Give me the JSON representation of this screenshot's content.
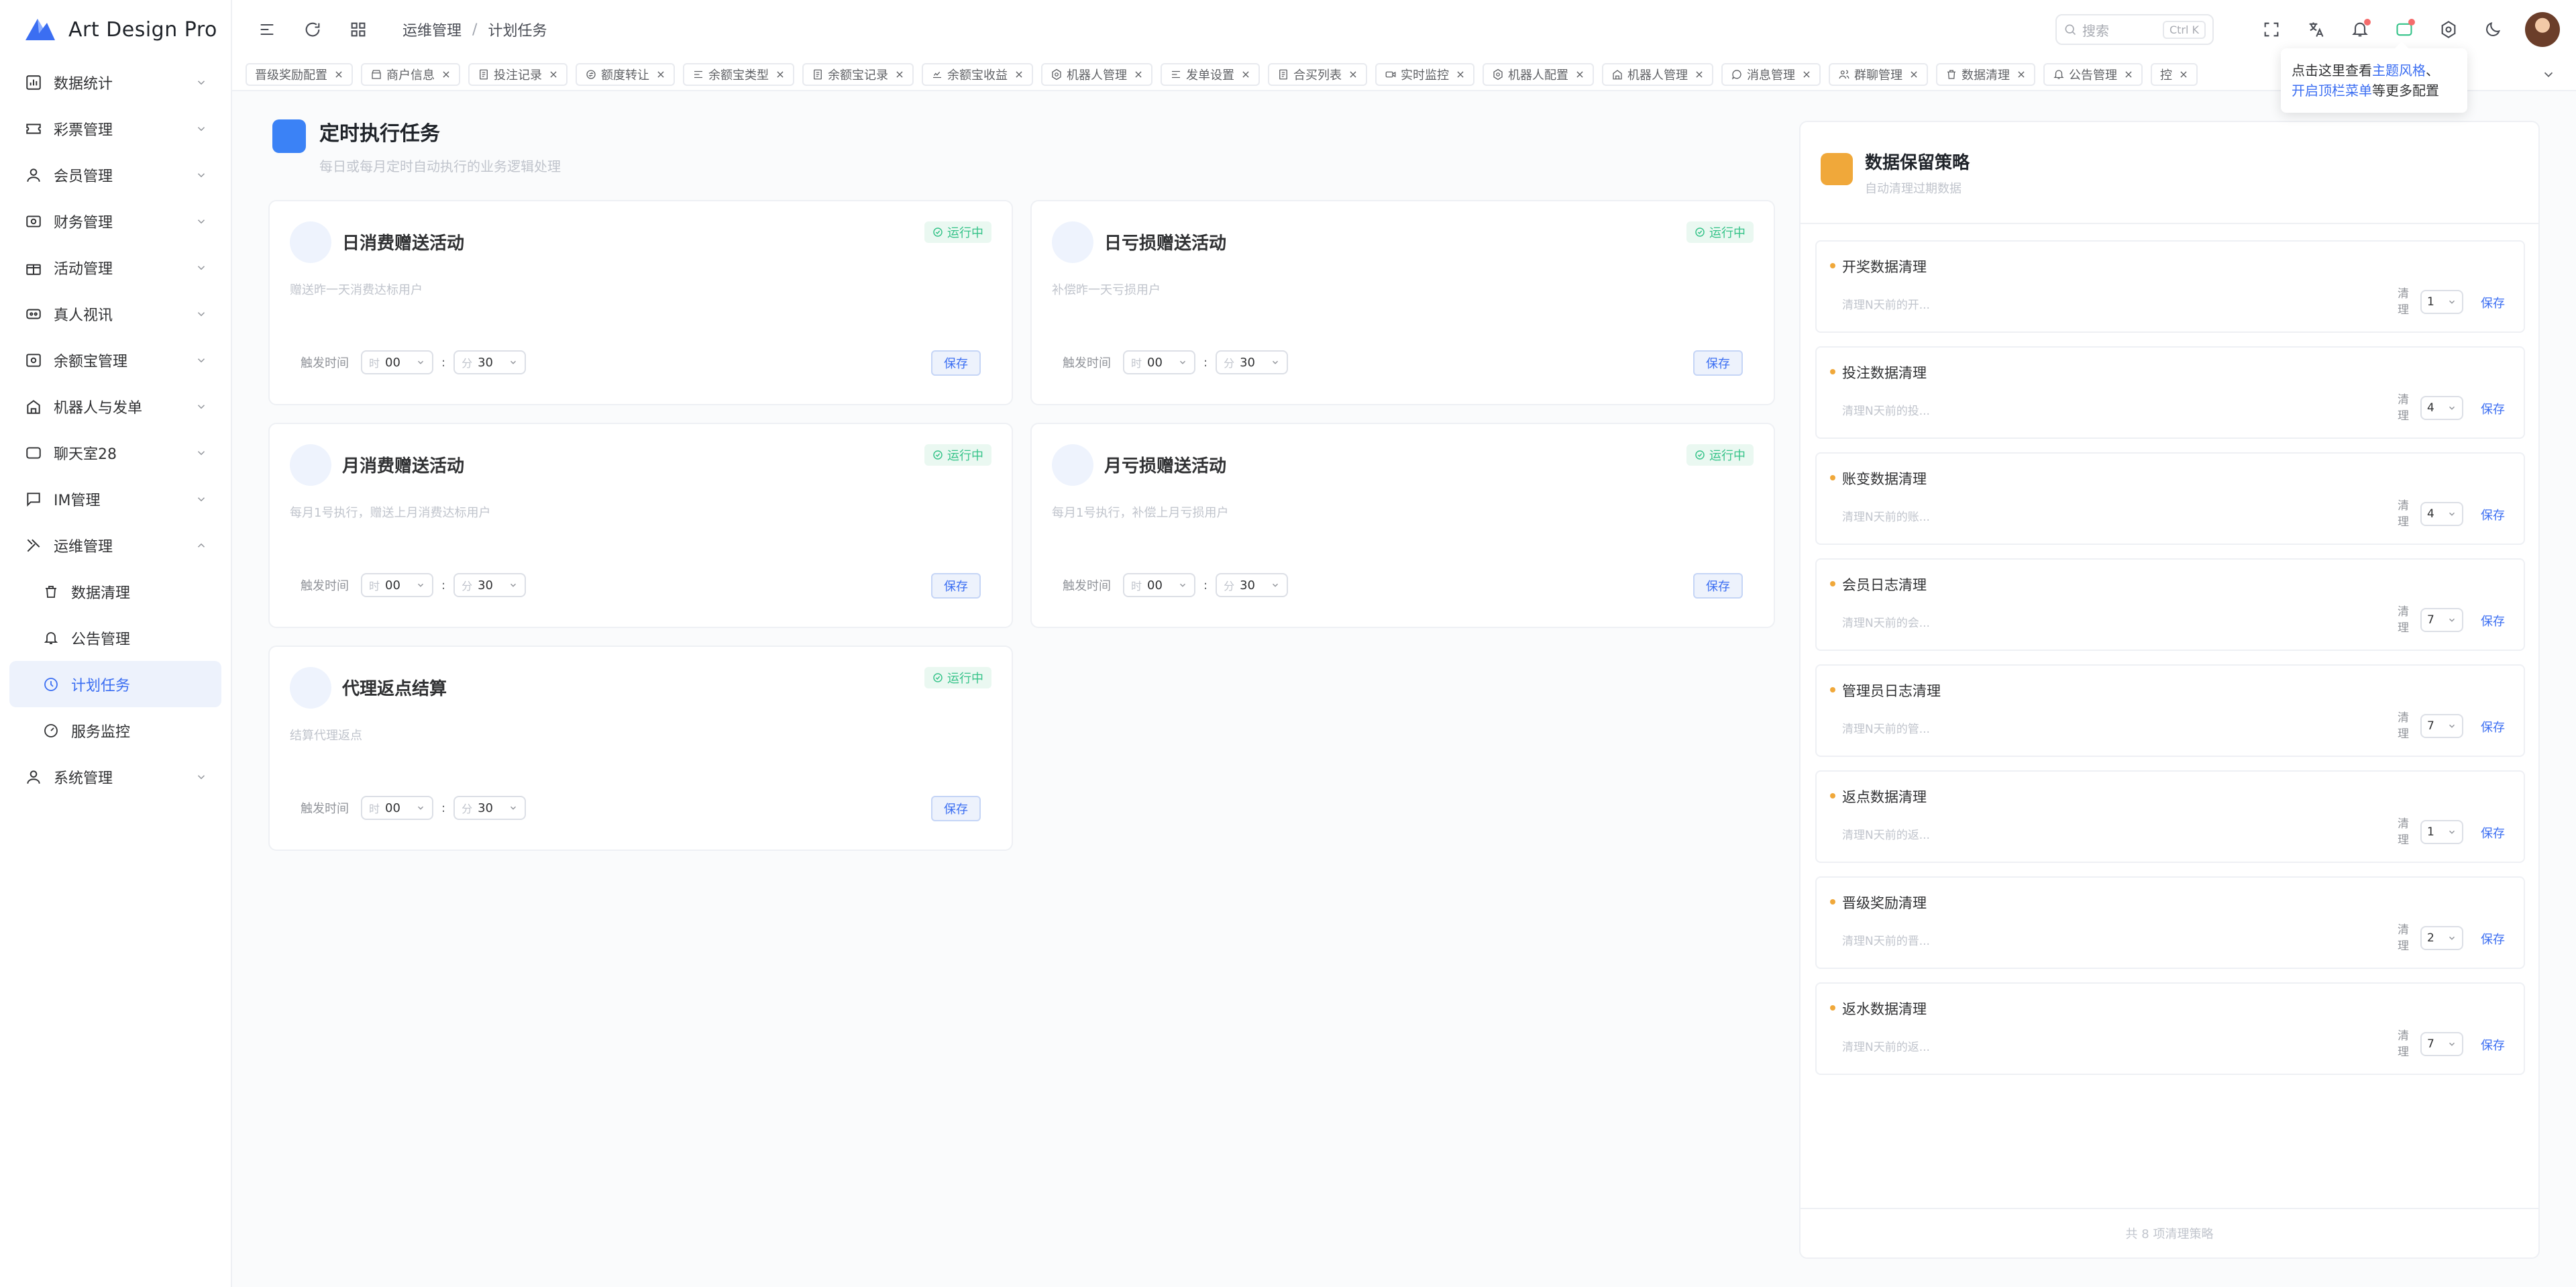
{
  "app": {
    "title": "Art Design Pro"
  },
  "sidebar": {
    "items": [
      {
        "label": "数据统计",
        "icon": "chart-icon"
      },
      {
        "label": "彩票管理",
        "icon": "ticket-icon"
      },
      {
        "label": "会员管理",
        "icon": "user-icon"
      },
      {
        "label": "财务管理",
        "icon": "finance-icon"
      },
      {
        "label": "活动管理",
        "icon": "gift-icon"
      },
      {
        "label": "真人视讯",
        "icon": "video-icon"
      },
      {
        "label": "余额宝管理",
        "icon": "wallet-icon"
      },
      {
        "label": "机器人与发单",
        "icon": "robot-icon"
      },
      {
        "label": "聊天室28",
        "icon": "chat-icon"
      },
      {
        "label": "IM管理",
        "icon": "message-icon"
      },
      {
        "label": "运维管理",
        "icon": "tools-icon"
      }
    ],
    "subitems": [
      {
        "label": "数据清理",
        "icon": "trash-icon"
      },
      {
        "label": "公告管理",
        "icon": "bell-icon"
      },
      {
        "label": "计划任务",
        "icon": "clock-icon"
      },
      {
        "label": "服务监控",
        "icon": "gauge-icon"
      }
    ],
    "last": {
      "label": "系统管理",
      "icon": "user-icon"
    }
  },
  "header": {
    "breadcrumb": [
      "运维管理",
      "计划任务"
    ],
    "search_placeholder": "搜索",
    "search_kbd": "Ctrl K"
  },
  "tabs": [
    {
      "label": "晋级奖励配置",
      "icon": ""
    },
    {
      "label": "商户信息",
      "icon": "store-icon"
    },
    {
      "label": "投注记录",
      "icon": "doc-icon"
    },
    {
      "label": "额度转让",
      "icon": "transfer-icon"
    },
    {
      "label": "余额宝类型",
      "icon": "list-icon"
    },
    {
      "label": "余额宝记录",
      "icon": "doc-icon"
    },
    {
      "label": "余额宝收益",
      "icon": "wallet-icon"
    },
    {
      "label": "机器人管理",
      "icon": "gear-icon"
    },
    {
      "label": "发单设置",
      "icon": "list-icon"
    },
    {
      "label": "合买列表",
      "icon": "doc-icon"
    },
    {
      "label": "实时监控",
      "icon": "video-icon"
    },
    {
      "label": "机器人配置",
      "icon": "gear-icon"
    },
    {
      "label": "机器人管理",
      "icon": "robot-icon"
    },
    {
      "label": "消息管理",
      "icon": "chat-icon"
    },
    {
      "label": "群聊管理",
      "icon": "users-icon"
    },
    {
      "label": "数据清理",
      "icon": "trash-icon"
    },
    {
      "label": "公告管理",
      "icon": "bell-icon"
    }
  ],
  "tab_partial": "控",
  "tooltip": {
    "prefix": "点击这里查看",
    "link1": "主题风格",
    "mid": "、",
    "link2": "开启顶栏菜单",
    "suffix": "等更多配置"
  },
  "section": {
    "title": "定时执行任务",
    "subtitle": "每日或每月定时自动执行的业务逻辑处理"
  },
  "common": {
    "trigger_label": "触发时间",
    "hour_prefix": "时",
    "minute_prefix": "分",
    "save": "保存",
    "status": "运行中"
  },
  "tasks": [
    {
      "title": "日消费赠送活动",
      "desc": "赠送昨一天消费达标用户",
      "hour": "00",
      "minute": "30"
    },
    {
      "title": "日亏损赠送活动",
      "desc": "补偿昨一天亏损用户",
      "hour": "00",
      "minute": "30"
    },
    {
      "title": "月消费赠送活动",
      "desc": "每月1号执行，赠送上月消费达标用户",
      "hour": "00",
      "minute": "30"
    },
    {
      "title": "月亏损赠送活动",
      "desc": "每月1号执行，补偿上月亏损用户",
      "hour": "00",
      "minute": "30"
    },
    {
      "title": "代理返点结算",
      "desc": "结算代理返点",
      "hour": "00",
      "minute": "30"
    }
  ],
  "retention": {
    "title": "数据保留策略",
    "subtitle": "自动清理过期数据",
    "clean_label": "清理",
    "save": "保存",
    "footer": "共 8 项清理策略",
    "policies": [
      {
        "title": "开奖数据清理",
        "placeholder": "清理N天前的开...",
        "value": "1"
      },
      {
        "title": "投注数据清理",
        "placeholder": "清理N天前的投...",
        "value": "4"
      },
      {
        "title": "账变数据清理",
        "placeholder": "清理N天前的账...",
        "value": "4"
      },
      {
        "title": "会员日志清理",
        "placeholder": "清理N天前的会...",
        "value": "7"
      },
      {
        "title": "管理员日志清理",
        "placeholder": "清理N天前的管...",
        "value": "7"
      },
      {
        "title": "返点数据清理",
        "placeholder": "清理N天前的返...",
        "value": "1"
      },
      {
        "title": "晋级奖励清理",
        "placeholder": "清理N天前的晋...",
        "value": "2"
      },
      {
        "title": "返水数据清理",
        "placeholder": "清理N天前的返...",
        "value": "7"
      }
    ]
  },
  "colors": {
    "accent": "#3b6ef2",
    "success": "#35c389",
    "warning": "#f0a83a",
    "primary_block": "#3b82f6"
  }
}
